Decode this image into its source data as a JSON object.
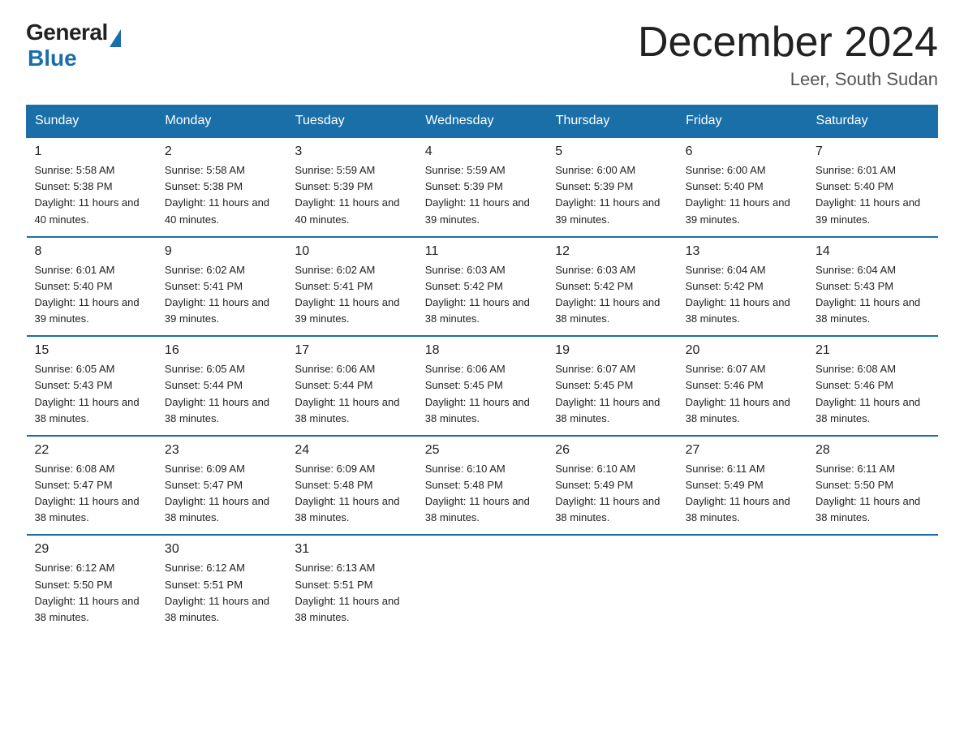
{
  "logo": {
    "text_general": "General",
    "text_blue": "Blue"
  },
  "header": {
    "month_title": "December 2024",
    "location": "Leer, South Sudan"
  },
  "weekdays": [
    "Sunday",
    "Monday",
    "Tuesday",
    "Wednesday",
    "Thursday",
    "Friday",
    "Saturday"
  ],
  "weeks": [
    [
      {
        "day": "1",
        "sunrise": "5:58 AM",
        "sunset": "5:38 PM",
        "daylight": "11 hours and 40 minutes."
      },
      {
        "day": "2",
        "sunrise": "5:58 AM",
        "sunset": "5:38 PM",
        "daylight": "11 hours and 40 minutes."
      },
      {
        "day": "3",
        "sunrise": "5:59 AM",
        "sunset": "5:39 PM",
        "daylight": "11 hours and 40 minutes."
      },
      {
        "day": "4",
        "sunrise": "5:59 AM",
        "sunset": "5:39 PM",
        "daylight": "11 hours and 39 minutes."
      },
      {
        "day": "5",
        "sunrise": "6:00 AM",
        "sunset": "5:39 PM",
        "daylight": "11 hours and 39 minutes."
      },
      {
        "day": "6",
        "sunrise": "6:00 AM",
        "sunset": "5:40 PM",
        "daylight": "11 hours and 39 minutes."
      },
      {
        "day": "7",
        "sunrise": "6:01 AM",
        "sunset": "5:40 PM",
        "daylight": "11 hours and 39 minutes."
      }
    ],
    [
      {
        "day": "8",
        "sunrise": "6:01 AM",
        "sunset": "5:40 PM",
        "daylight": "11 hours and 39 minutes."
      },
      {
        "day": "9",
        "sunrise": "6:02 AM",
        "sunset": "5:41 PM",
        "daylight": "11 hours and 39 minutes."
      },
      {
        "day": "10",
        "sunrise": "6:02 AM",
        "sunset": "5:41 PM",
        "daylight": "11 hours and 39 minutes."
      },
      {
        "day": "11",
        "sunrise": "6:03 AM",
        "sunset": "5:42 PM",
        "daylight": "11 hours and 38 minutes."
      },
      {
        "day": "12",
        "sunrise": "6:03 AM",
        "sunset": "5:42 PM",
        "daylight": "11 hours and 38 minutes."
      },
      {
        "day": "13",
        "sunrise": "6:04 AM",
        "sunset": "5:42 PM",
        "daylight": "11 hours and 38 minutes."
      },
      {
        "day": "14",
        "sunrise": "6:04 AM",
        "sunset": "5:43 PM",
        "daylight": "11 hours and 38 minutes."
      }
    ],
    [
      {
        "day": "15",
        "sunrise": "6:05 AM",
        "sunset": "5:43 PM",
        "daylight": "11 hours and 38 minutes."
      },
      {
        "day": "16",
        "sunrise": "6:05 AM",
        "sunset": "5:44 PM",
        "daylight": "11 hours and 38 minutes."
      },
      {
        "day": "17",
        "sunrise": "6:06 AM",
        "sunset": "5:44 PM",
        "daylight": "11 hours and 38 minutes."
      },
      {
        "day": "18",
        "sunrise": "6:06 AM",
        "sunset": "5:45 PM",
        "daylight": "11 hours and 38 minutes."
      },
      {
        "day": "19",
        "sunrise": "6:07 AM",
        "sunset": "5:45 PM",
        "daylight": "11 hours and 38 minutes."
      },
      {
        "day": "20",
        "sunrise": "6:07 AM",
        "sunset": "5:46 PM",
        "daylight": "11 hours and 38 minutes."
      },
      {
        "day": "21",
        "sunrise": "6:08 AM",
        "sunset": "5:46 PM",
        "daylight": "11 hours and 38 minutes."
      }
    ],
    [
      {
        "day": "22",
        "sunrise": "6:08 AM",
        "sunset": "5:47 PM",
        "daylight": "11 hours and 38 minutes."
      },
      {
        "day": "23",
        "sunrise": "6:09 AM",
        "sunset": "5:47 PM",
        "daylight": "11 hours and 38 minutes."
      },
      {
        "day": "24",
        "sunrise": "6:09 AM",
        "sunset": "5:48 PM",
        "daylight": "11 hours and 38 minutes."
      },
      {
        "day": "25",
        "sunrise": "6:10 AM",
        "sunset": "5:48 PM",
        "daylight": "11 hours and 38 minutes."
      },
      {
        "day": "26",
        "sunrise": "6:10 AM",
        "sunset": "5:49 PM",
        "daylight": "11 hours and 38 minutes."
      },
      {
        "day": "27",
        "sunrise": "6:11 AM",
        "sunset": "5:49 PM",
        "daylight": "11 hours and 38 minutes."
      },
      {
        "day": "28",
        "sunrise": "6:11 AM",
        "sunset": "5:50 PM",
        "daylight": "11 hours and 38 minutes."
      }
    ],
    [
      {
        "day": "29",
        "sunrise": "6:12 AM",
        "sunset": "5:50 PM",
        "daylight": "11 hours and 38 minutes."
      },
      {
        "day": "30",
        "sunrise": "6:12 AM",
        "sunset": "5:51 PM",
        "daylight": "11 hours and 38 minutes."
      },
      {
        "day": "31",
        "sunrise": "6:13 AM",
        "sunset": "5:51 PM",
        "daylight": "11 hours and 38 minutes."
      },
      null,
      null,
      null,
      null
    ]
  ]
}
